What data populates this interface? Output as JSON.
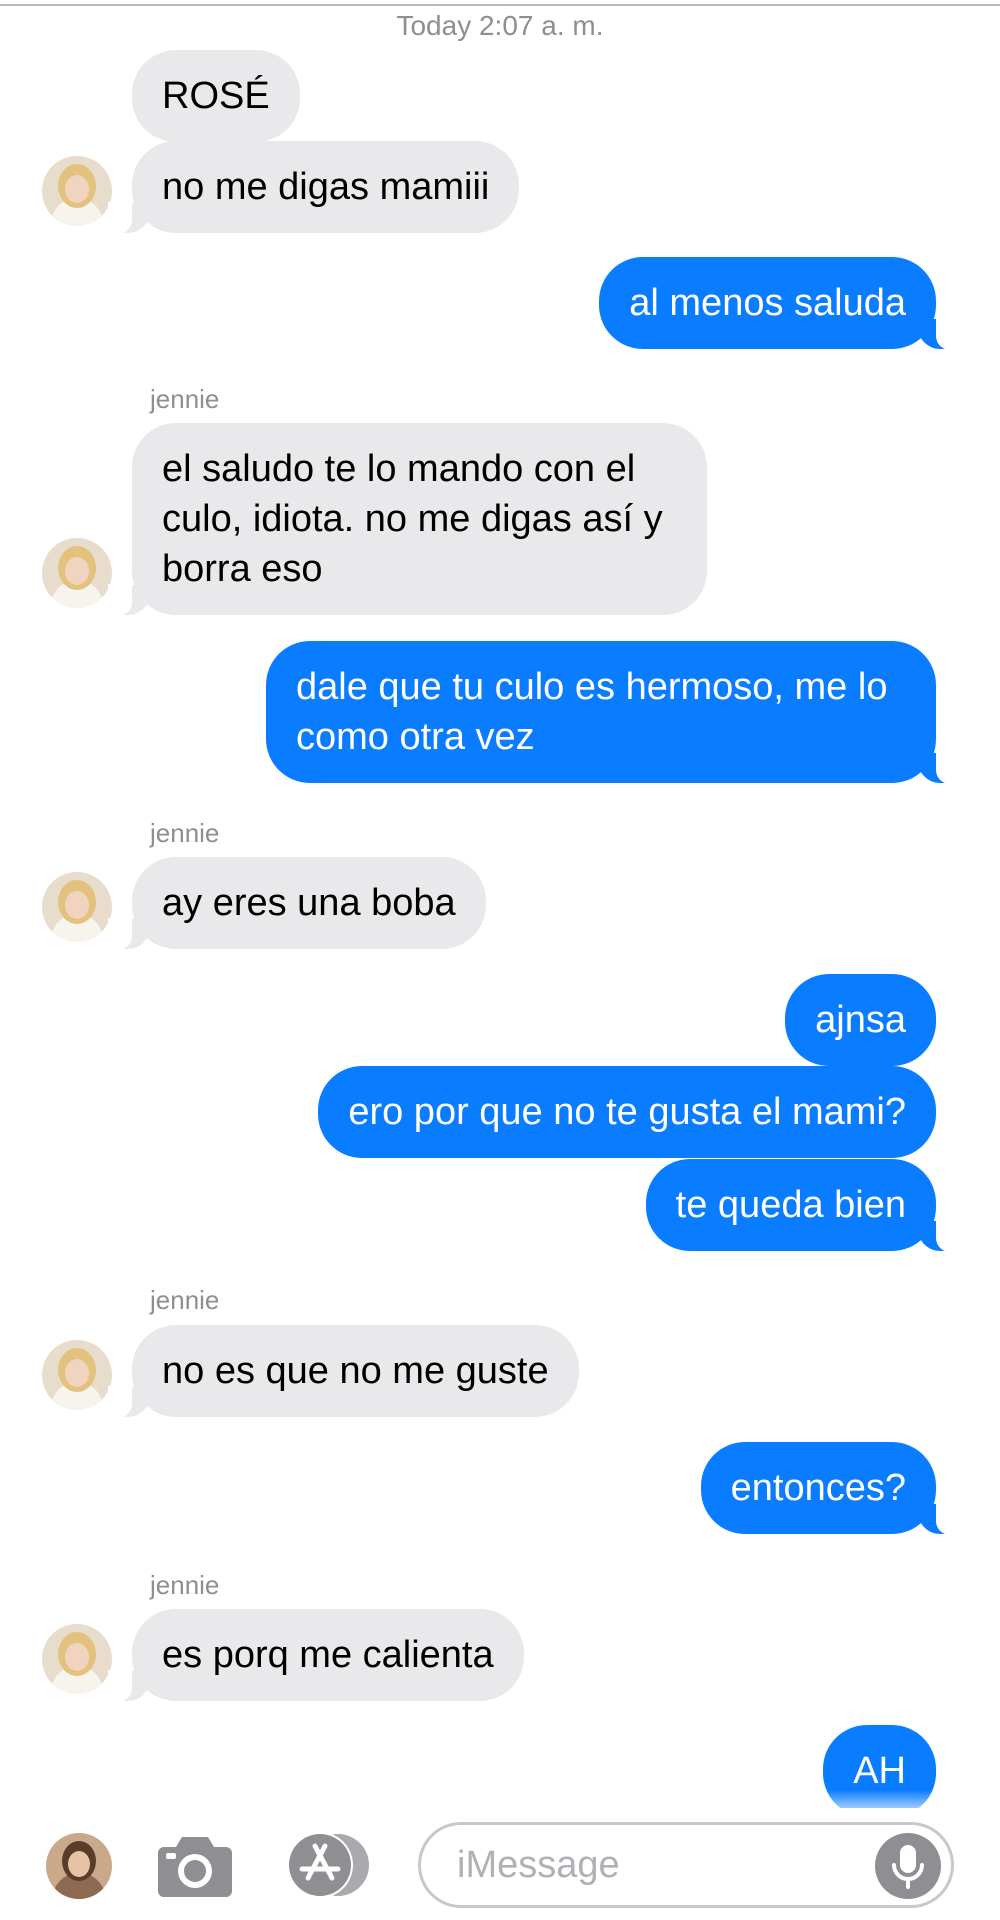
{
  "conversation": {
    "timestamp": "Today 2:07 a. m.",
    "messages": [
      {
        "from": "contact",
        "text": "ROSÉ"
      },
      {
        "from": "contact",
        "text": "no me digas mamiii"
      },
      {
        "from": "me",
        "text": "al menos saluda"
      },
      {
        "from": "contact",
        "sender_name": "jennie",
        "text": "el saludo te lo mando con el culo, idiota. no me digas así y borra eso"
      },
      {
        "from": "me",
        "text": "dale que tu culo es hermoso, me lo como otra vez"
      },
      {
        "from": "contact",
        "sender_name": "jennie",
        "text": "ay eres una boba"
      },
      {
        "from": "me",
        "text": "ajnsa"
      },
      {
        "from": "me",
        "text": "ero por que no te gusta el mami?"
      },
      {
        "from": "me",
        "text": "te queda bien"
      },
      {
        "from": "contact",
        "sender_name": "jennie",
        "text": "no es que no me guste"
      },
      {
        "from": "me",
        "text": "entonces?"
      },
      {
        "from": "contact",
        "sender_name": "jennie",
        "text": "es porq me calienta"
      },
      {
        "from": "me",
        "text": "AH"
      }
    ]
  },
  "compose": {
    "placeholder": "iMessage",
    "value": ""
  },
  "icons": {
    "camera": "camera-icon",
    "apps": "app-store-icon",
    "mic": "microphone-icon"
  },
  "colors": {
    "sent_bubble": "#0a7cff",
    "received_bubble": "#e9e9eb",
    "meta_text": "#8e8e93"
  }
}
